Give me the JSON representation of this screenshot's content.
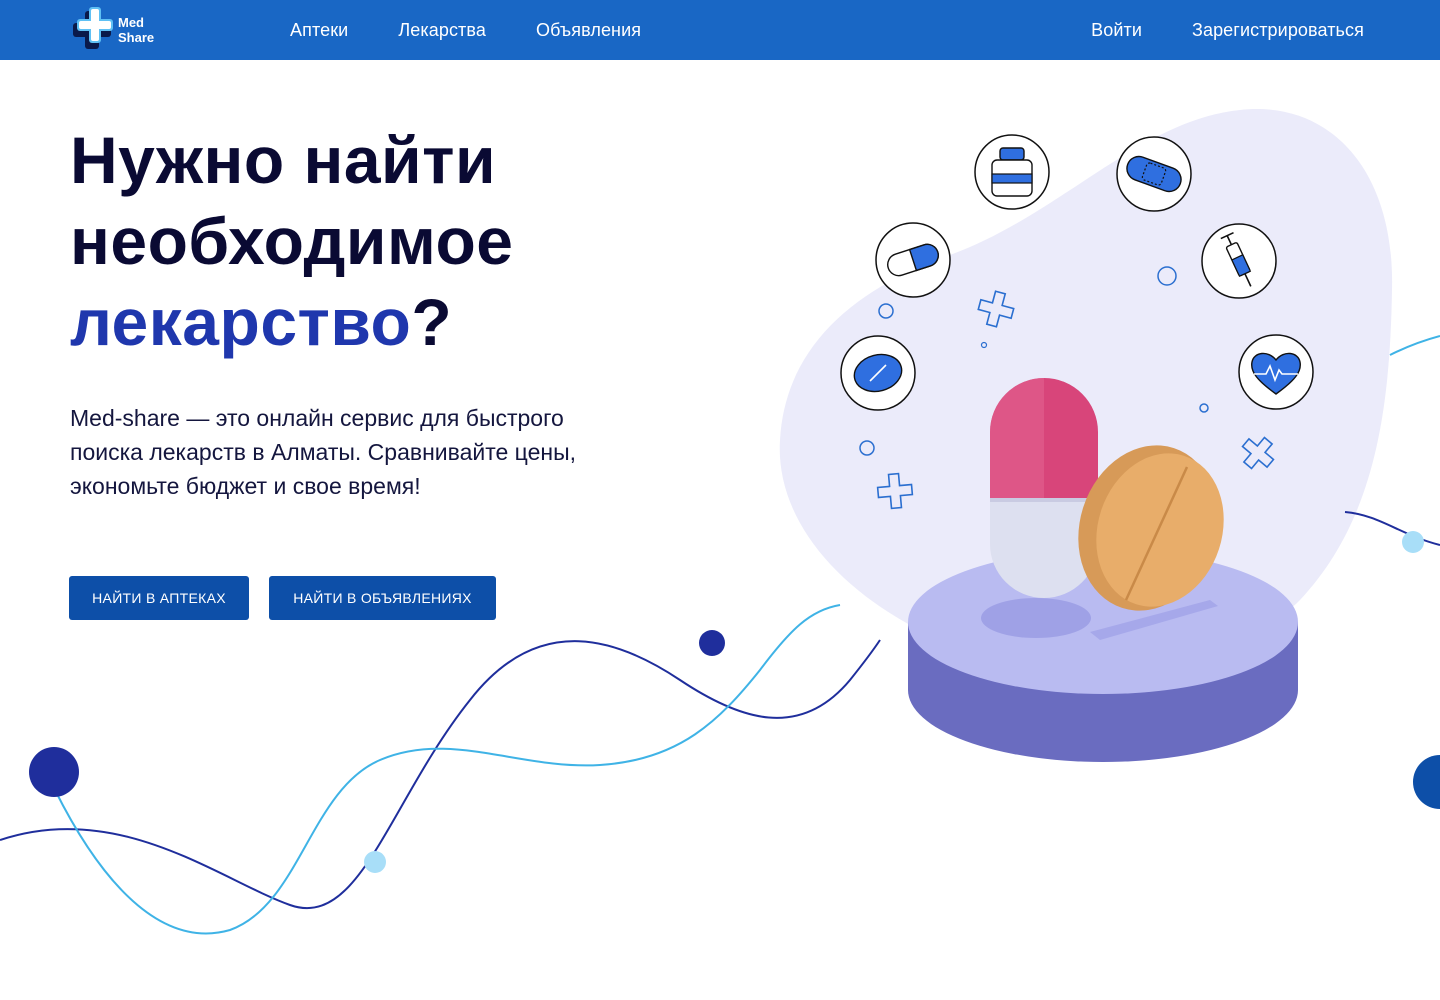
{
  "header": {
    "logo": {
      "line1": "Med",
      "line2": "Share"
    },
    "nav_left": [
      {
        "label": "Аптеки"
      },
      {
        "label": "Лекарства"
      },
      {
        "label": "Объявления"
      }
    ],
    "nav_right": [
      {
        "label": "Войти"
      },
      {
        "label": "Зарегистрироваться"
      }
    ]
  },
  "hero": {
    "title_line1": "Нужно найти",
    "title_line2": "необходимое",
    "title_accent": "лекарство",
    "title_end": "?",
    "description": "Med-share — это онлайн сервис для быстрого поиска лекарств в Алматы. Сравнивайте цены, экономьте бюджет и свое время!",
    "buttons": {
      "pharmacies": "НАЙТИ В АПТЕКАХ",
      "ads": "НАЙТИ В ОБЪЯВЛЕНИЯХ"
    }
  },
  "illustration": {
    "icons": [
      "pill-bottle-icon",
      "bandage-icon",
      "capsule-icon",
      "syringe-icon",
      "tablet-icon",
      "heart-pulse-icon"
    ]
  },
  "colors": {
    "header_bg": "#1967c5",
    "button_bg": "#0d4fa8",
    "accent_text": "#1f37ad",
    "dark_text": "#0a0a33",
    "blob": "#ebebfa",
    "wave_light": "#3fb3e6",
    "wave_dark": "#1f2e9c"
  }
}
